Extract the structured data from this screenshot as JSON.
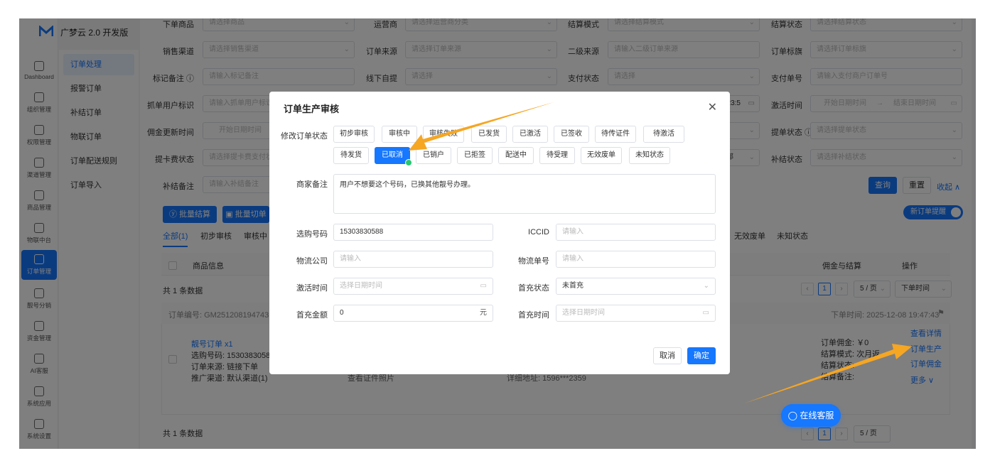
{
  "app": {
    "title": "广梦云 2.0 开发版"
  },
  "rail": [
    {
      "label": "Dashboard",
      "icon": "dashboard-icon"
    },
    {
      "label": "组织管理",
      "icon": "org-icon"
    },
    {
      "label": "权限管理",
      "icon": "monitor-icon"
    },
    {
      "label": "渠道管理",
      "icon": "network-icon"
    },
    {
      "label": "商品管理",
      "icon": "shop-icon"
    },
    {
      "label": "物联中台",
      "icon": "iot-icon"
    },
    {
      "label": "订单管理",
      "icon": "list-icon"
    },
    {
      "label": "靓号分销",
      "icon": "phone-icon"
    },
    {
      "label": "资金管理",
      "icon": "yen-icon"
    },
    {
      "label": "AI客服",
      "icon": "ai-icon"
    },
    {
      "label": "系统应用",
      "icon": "cube-icon"
    },
    {
      "label": "系统设置",
      "icon": "settings-icon"
    }
  ],
  "submenu": [
    "订单处理",
    "报警订单",
    "补结订单",
    "物联订单",
    "订单配送规则",
    "订单导入"
  ],
  "filters": {
    "row1": [
      {
        "label": "下单商品",
        "placeholder": "请选择商品"
      },
      {
        "label": "运营商",
        "placeholder": "请选择运营商分类"
      },
      {
        "label": "结算模式",
        "placeholder": "请选择结算模式"
      },
      {
        "label": "结算状态",
        "placeholder": "请选择结算状态"
      }
    ],
    "row2": [
      {
        "label": "销售渠道",
        "placeholder": "请选择销售渠道"
      },
      {
        "label": "订单来源",
        "placeholder": "请选择订单来源"
      },
      {
        "label": "二级来源",
        "placeholder": "请输入二级订单来源"
      },
      {
        "label": "订单标旗",
        "placeholder": "请选择订单标旗"
      }
    ],
    "row3": [
      {
        "label": "标记备注",
        "placeholder": "请输入标记备注"
      },
      {
        "label": "线下自提",
        "placeholder": "请选择"
      },
      {
        "label": "支付状态",
        "placeholder": "请选择"
      },
      {
        "label": "支付单号",
        "placeholder": "请输入支付商户订单号"
      }
    ],
    "row4": [
      {
        "label": "抓单用户标识",
        "placeholder": "请输入抓单用户标识"
      },
      {
        "label": "激活时间",
        "placeholder_start": "开始日期时间",
        "placeholder_end": "结束日期时间",
        "partial_value": "23:5"
      }
    ],
    "row5": [
      {
        "label": "佣金更新时间",
        "placeholder": "开始日期时间"
      },
      {
        "label": "提单状态",
        "placeholder": "请选择提单状态"
      }
    ],
    "row6": [
      {
        "label": "提卡费状态",
        "placeholder": "请选择提卡费支付状态"
      },
      {
        "label": "补结状态",
        "placeholder": "请选择补结状态",
        "partial_value": "部"
      }
    ],
    "row7": [
      {
        "label": "补结备注",
        "placeholder": "请输入补结备注"
      }
    ],
    "query_btn": "查询",
    "reset_btn": "重置",
    "collapse_link": "收起 ∧"
  },
  "actions": {
    "batch_settle": "批量结算",
    "batch_switch": "批量切单"
  },
  "new_order_toggle": "新订单提醒",
  "tabs": [
    "全部(1)",
    "初步审核",
    "审核中",
    "无效废单",
    "未知状态"
  ],
  "table": {
    "headers": [
      "商品信息",
      "佣金与结算",
      "操作"
    ],
    "total_top": "共 1 条数据",
    "total_bottom": "共 1 条数据",
    "page": "1",
    "page_size": "5 / 页",
    "sort": "下单时间",
    "order_no": "订单编号: GM2512081947431",
    "order_time": "下单时间: 2025-12-08 19:47:43",
    "product": "靓号订单 x1",
    "phone_line": "选购号码: 15303830588",
    "source_line": "订单来源: 链接下单",
    "channel_line": "推广渠道: 默认渠道(1)",
    "cert_photo": "查看证件照片",
    "address": "详细地址: 1596***2359",
    "commission": "订单佣金: ￥0",
    "settle_mode": "结算模式: 次月返",
    "settle_status": "结算状态:",
    "settle_note": "结算备注:",
    "ops": [
      "查看详情",
      "订单生产",
      "订单佣金",
      "更多 ∨"
    ]
  },
  "chat_button": "在线客服",
  "modal": {
    "title": "订单生产审核",
    "status_label": "修改订单状态",
    "statuses": [
      "初步审核",
      "审核中",
      "审核失败",
      "已发货",
      "已激活",
      "已签收",
      "待传证件",
      "待激活",
      "待发货",
      "已取消",
      "已销户",
      "已拒签",
      "配送中",
      "待受理",
      "无效废单",
      "未知状态"
    ],
    "selected_status": "已取消",
    "remark_label": "商家备注",
    "remark_value": "用户不想要这个号码，已换其他靓号办理。",
    "fields": {
      "phone": {
        "label": "选购号码",
        "value": "15303830588"
      },
      "iccid": {
        "label": "ICCID",
        "placeholder": "请输入"
      },
      "logistics_company": {
        "label": "物流公司",
        "placeholder": "请输入"
      },
      "logistics_no": {
        "label": "物流单号",
        "placeholder": "请输入"
      },
      "activation_time": {
        "label": "激活时间",
        "placeholder": "选择日期时间"
      },
      "first_charge_status": {
        "label": "首充状态",
        "value": "未首充"
      },
      "first_charge_amount": {
        "label": "首充金额",
        "value": "0",
        "suffix": "元"
      },
      "first_charge_time": {
        "label": "首充时间",
        "placeholder": "选择日期时间"
      }
    },
    "cancel": "取消",
    "confirm": "确定"
  },
  "colors": {
    "primary": "#1677ff",
    "arrow": "#f5a623",
    "success": "#28c76f"
  }
}
